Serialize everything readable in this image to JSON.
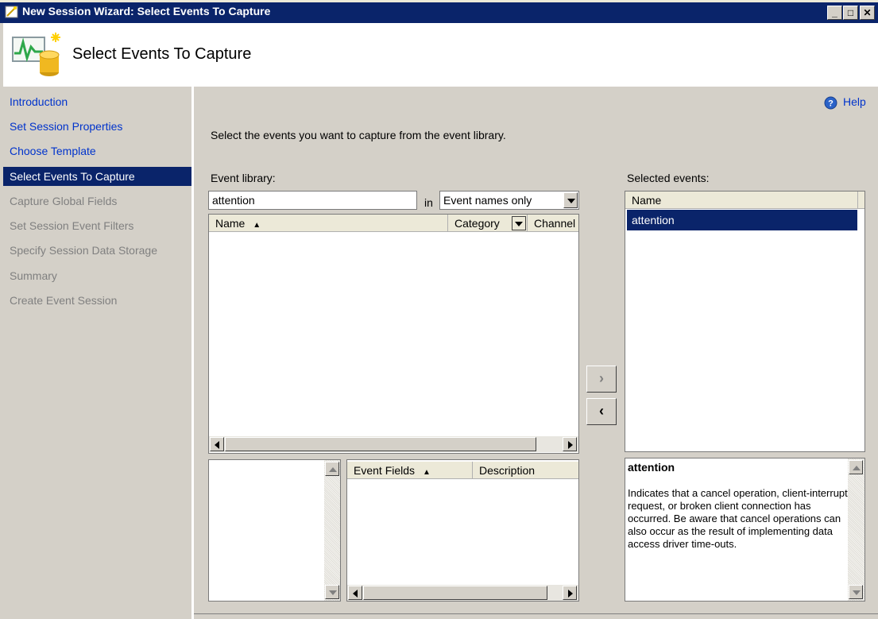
{
  "window": {
    "title": "New Session Wizard: Select Events To Capture",
    "minimize_glyph": "_",
    "maximize_glyph": "□",
    "close_glyph": "✕"
  },
  "header": {
    "title": "Select Events To Capture",
    "icon": "monitor-chart-database-icon"
  },
  "nav": {
    "items": [
      {
        "label": "Introduction",
        "state": "link"
      },
      {
        "label": "Set Session Properties",
        "state": "link"
      },
      {
        "label": "Choose Template",
        "state": "link"
      },
      {
        "label": "Select Events To Capture",
        "state": "selected"
      },
      {
        "label": "Capture Global Fields",
        "state": "disabled"
      },
      {
        "label": "Set Session Event Filters",
        "state": "disabled"
      },
      {
        "label": "Specify Session Data Storage",
        "state": "disabled"
      },
      {
        "label": "Summary",
        "state": "disabled"
      },
      {
        "label": "Create Event Session",
        "state": "disabled"
      }
    ]
  },
  "help": {
    "label": "Help",
    "icon": "help-icon"
  },
  "instructions": "Select the events you want to capture from the event library.",
  "library": {
    "label": "Event library:",
    "search_value": "attention",
    "in_label": "in",
    "filter_selected": "Event names only",
    "columns": [
      "Name",
      "Category",
      "Channel"
    ],
    "sort_column": "Name"
  },
  "fields": {
    "columns": [
      "Event Fields",
      "Description"
    ]
  },
  "buttons": {
    "add": "›",
    "remove": "‹"
  },
  "selected": {
    "label": "Selected events:",
    "column": "Name",
    "rows": [
      "attention"
    ]
  },
  "description": {
    "title": "attention",
    "body": "Indicates that a cancel operation, client-interrupt request, or broken client connection has occurred. Be aware that cancel operations can also occur as the result of implementing data access driver time-outs."
  },
  "colors": {
    "titlebar": "#0a246a",
    "selection": "#0a246a",
    "link": "#0033cc",
    "face": "#d4d0c8"
  }
}
